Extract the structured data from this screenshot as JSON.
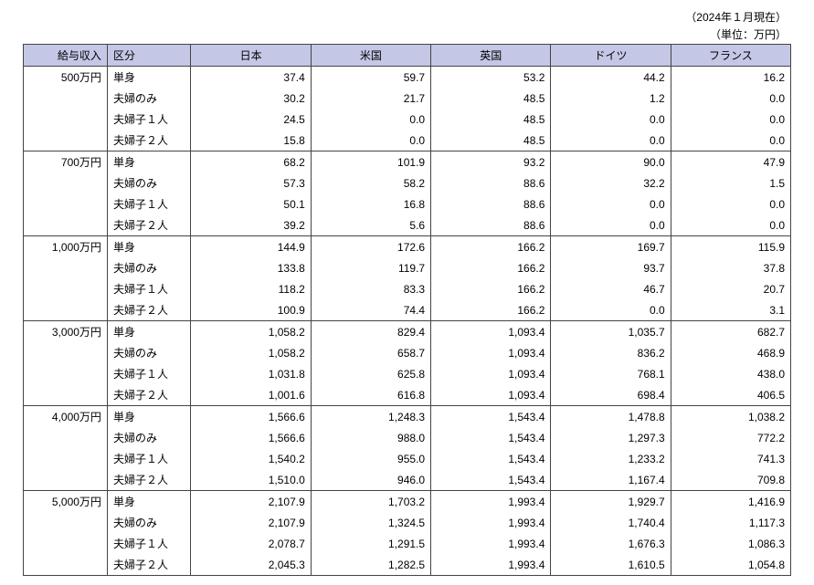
{
  "notes": {
    "date": "（2024年１月現在）",
    "unit": "（単位：万円）"
  },
  "headers": {
    "income": "給与収入",
    "category": "区分",
    "japan": "日本",
    "usa": "米国",
    "uk": "英国",
    "germany": "ドイツ",
    "france": "フランス"
  },
  "categories": [
    "単身",
    "夫婦のみ",
    "夫婦子１人",
    "夫婦子２人"
  ],
  "groups": [
    {
      "income": "500万円",
      "rows": [
        [
          "37.4",
          "59.7",
          "53.2",
          "44.2",
          "16.2"
        ],
        [
          "30.2",
          "21.7",
          "48.5",
          "1.2",
          "0.0"
        ],
        [
          "24.5",
          "0.0",
          "48.5",
          "0.0",
          "0.0"
        ],
        [
          "15.8",
          "0.0",
          "48.5",
          "0.0",
          "0.0"
        ]
      ]
    },
    {
      "income": "700万円",
      "rows": [
        [
          "68.2",
          "101.9",
          "93.2",
          "90.0",
          "47.9"
        ],
        [
          "57.3",
          "58.2",
          "88.6",
          "32.2",
          "1.5"
        ],
        [
          "50.1",
          "16.8",
          "88.6",
          "0.0",
          "0.0"
        ],
        [
          "39.2",
          "5.6",
          "88.6",
          "0.0",
          "0.0"
        ]
      ]
    },
    {
      "income": "1,000万円",
      "rows": [
        [
          "144.9",
          "172.6",
          "166.2",
          "169.7",
          "115.9"
        ],
        [
          "133.8",
          "119.7",
          "166.2",
          "93.7",
          "37.8"
        ],
        [
          "118.2",
          "83.3",
          "166.2",
          "46.7",
          "20.7"
        ],
        [
          "100.9",
          "74.4",
          "166.2",
          "0.0",
          "3.1"
        ]
      ]
    },
    {
      "income": "3,000万円",
      "rows": [
        [
          "1,058.2",
          "829.4",
          "1,093.4",
          "1,035.7",
          "682.7"
        ],
        [
          "1,058.2",
          "658.7",
          "1,093.4",
          "836.2",
          "468.9"
        ],
        [
          "1,031.8",
          "625.8",
          "1,093.4",
          "768.1",
          "438.0"
        ],
        [
          "1,001.6",
          "616.8",
          "1,093.4",
          "698.4",
          "406.5"
        ]
      ]
    },
    {
      "income": "4,000万円",
      "rows": [
        [
          "1,566.6",
          "1,248.3",
          "1,543.4",
          "1,478.8",
          "1,038.2"
        ],
        [
          "1,566.6",
          "988.0",
          "1,543.4",
          "1,297.3",
          "772.2"
        ],
        [
          "1,540.2",
          "955.0",
          "1,543.4",
          "1,233.2",
          "741.3"
        ],
        [
          "1,510.0",
          "946.0",
          "1,543.4",
          "1,167.4",
          "709.8"
        ]
      ]
    },
    {
      "income": "5,000万円",
      "rows": [
        [
          "2,107.9",
          "1,703.2",
          "1,993.4",
          "1,929.7",
          "1,416.9"
        ],
        [
          "2,107.9",
          "1,324.5",
          "1,993.4",
          "1,740.4",
          "1,117.3"
        ],
        [
          "2,078.7",
          "1,291.5",
          "1,993.4",
          "1,676.3",
          "1,086.3"
        ],
        [
          "2,045.3",
          "1,282.5",
          "1,993.4",
          "1,610.5",
          "1,054.8"
        ]
      ]
    }
  ]
}
